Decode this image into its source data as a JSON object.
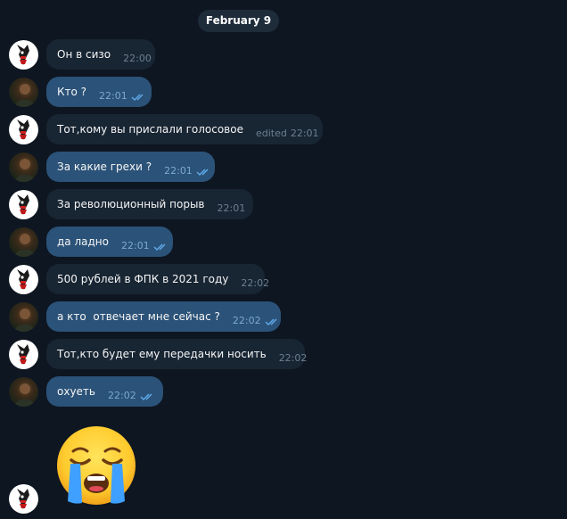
{
  "date_label": "February 9",
  "messages": [
    {
      "text": "Он в сизо",
      "time": "22:00",
      "edited": "",
      "dir": "in"
    },
    {
      "text": "Кто ?",
      "time": "22:01",
      "edited": "",
      "dir": "out"
    },
    {
      "text": "Тот,кому вы прислали голосовое",
      "time": "22:01",
      "edited": "edited",
      "dir": "in"
    },
    {
      "text": "За какие грехи ?",
      "time": "22:01",
      "edited": "",
      "dir": "out"
    },
    {
      "text": "За революционный порыв",
      "time": "22:01",
      "edited": "",
      "dir": "in"
    },
    {
      "text": "да ладно",
      "time": "22:01",
      "edited": "",
      "dir": "out"
    },
    {
      "text": "500 рублей в ФПК в 2021 году",
      "time": "22:02",
      "edited": "",
      "dir": "in"
    },
    {
      "text": "а кто  отвечает мне сейчас ?",
      "time": "22:02",
      "edited": "",
      "dir": "out"
    },
    {
      "text": "Тот,кто будет ему передачки носить",
      "time": "22:02",
      "edited": "",
      "dir": "in"
    },
    {
      "text": "охуеть",
      "time": "22:02",
      "edited": "",
      "dir": "out"
    }
  ],
  "sticker": {
    "icon": "loudly-crying-face-icon"
  },
  "colors": {
    "background": "#0e1621",
    "incoming": "#182533",
    "outgoing": "#2b5278",
    "ticks": "#5fa8e8"
  }
}
